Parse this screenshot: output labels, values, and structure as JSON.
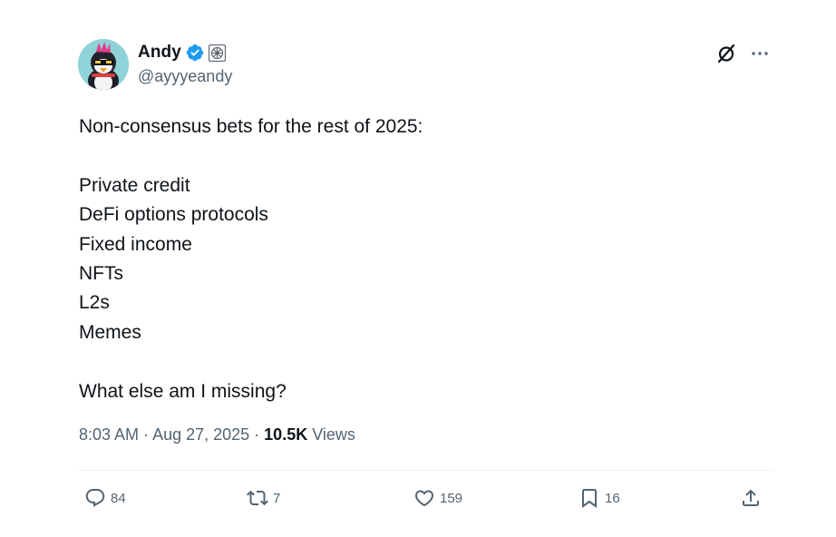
{
  "author": {
    "display_name": "Andy",
    "handle": "@ayyyeandy",
    "verified_color": "#1d9bf0"
  },
  "tweet": {
    "lines": [
      "Non-consensus bets for the rest of 2025:",
      "",
      "Private credit",
      "DeFi options protocols",
      "Fixed income",
      "NFTs",
      "L2s",
      "Memes",
      "",
      "What else am I missing?"
    ]
  },
  "meta": {
    "time": "8:03 AM",
    "separator": " · ",
    "date": "Aug 27, 2025",
    "views_count": "10.5K",
    "views_label": " Views"
  },
  "actions": {
    "replies": "84",
    "reposts": "7",
    "likes": "159",
    "bookmarks": "16"
  },
  "icons": {
    "verified": "verified-badge-icon",
    "affiliate": "affiliate-badge-icon",
    "grok": "grok-icon",
    "more": "more-icon",
    "reply": "reply-icon",
    "repost": "repost-icon",
    "like": "heart-icon",
    "bookmark": "bookmark-icon",
    "share": "share-icon"
  }
}
